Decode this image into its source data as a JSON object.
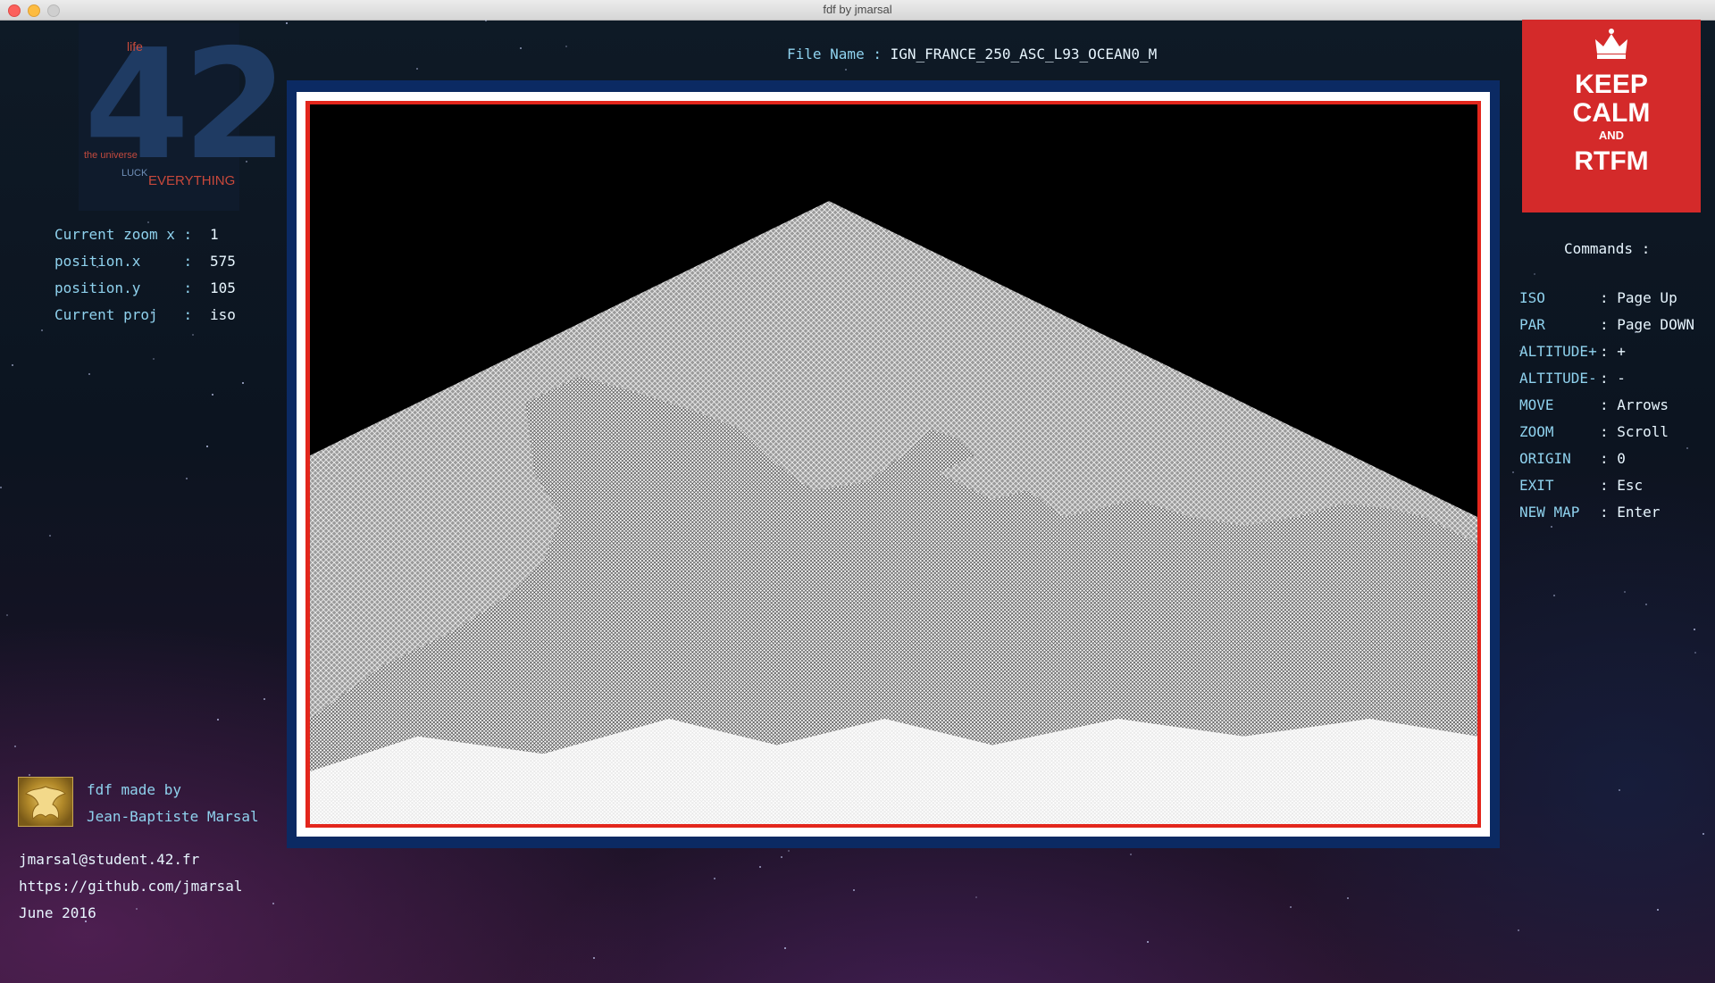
{
  "window": {
    "title": "fdf by jmarsal"
  },
  "logo": {
    "number": "42",
    "words": {
      "everything": "EVERYTHING",
      "universe": "the universe",
      "life": "life",
      "luck": "LUCK"
    }
  },
  "stats": [
    {
      "label": "Current zoom x :",
      "value": "1"
    },
    {
      "label": "position.x     :",
      "value": "575"
    },
    {
      "label": "position.y     :",
      "value": "105"
    },
    {
      "label": "Current proj   :",
      "value": "iso"
    }
  ],
  "file": {
    "label": "File Name : ",
    "value": "IGN_FRANCE_250_ASC_L93_OCEAN0_M"
  },
  "poster": {
    "line1": "KEEP",
    "line2": "CALM",
    "line3": "AND",
    "line4": "RTFM"
  },
  "commands": {
    "title": "Commands :",
    "items": [
      {
        "key": "ISO",
        "value": ": Page Up"
      },
      {
        "key": "PAR",
        "value": ": Page DOWN"
      },
      {
        "key": "ALTITUDE+",
        "value": ": +"
      },
      {
        "key": "ALTITUDE-",
        "value": ": -"
      },
      {
        "key": "MOVE",
        "value": ": Arrows"
      },
      {
        "key": "ZOOM",
        "value": ": Scroll"
      },
      {
        "key": "ORIGIN",
        "value": ": 0"
      },
      {
        "key": "EXIT",
        "value": ": Esc"
      },
      {
        "key": "NEW MAP",
        "value": ": Enter"
      }
    ]
  },
  "credits": {
    "made_by": "fdf made by",
    "author": "Jean-Baptiste Marsal",
    "email": "jmarsal@student.42.fr",
    "github": "https://github.com/jmarsal",
    "date": "June 2016"
  },
  "colors": {
    "label": "#8fd2ee",
    "value": "#e8f6ff",
    "frame_blue": "#0b2a63",
    "frame_red": "#e3261c",
    "poster_red": "#d42a2a"
  }
}
